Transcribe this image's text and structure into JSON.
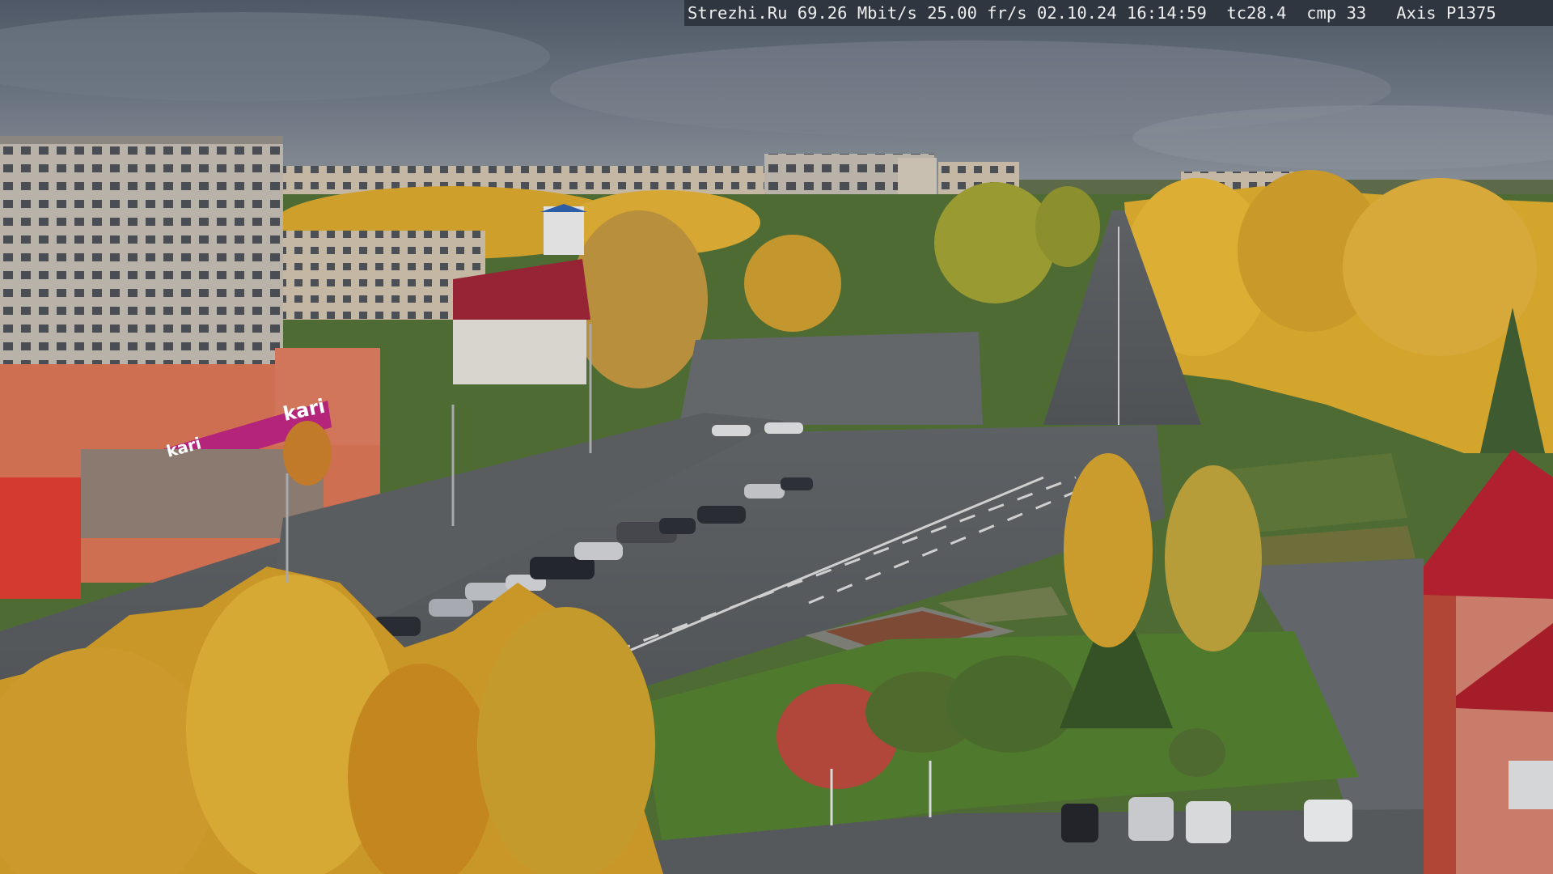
{
  "osd": {
    "text": "Strezhi.Ru 69.26 Mbit/s 25.00 fr/s 02.10.24 16:14:59  tc28.4  cmp 33   Axis P1375"
  },
  "signs": {
    "kari_large": "kari",
    "kari_small": "kari"
  },
  "palette": {
    "sky": "#5f6a78",
    "asphalt": "#55595c",
    "grass": "#4f7a2e",
    "foliage_yellow": "#d2a02a",
    "facade_magenta": "#b3247a",
    "roof_red": "#b0202e"
  }
}
